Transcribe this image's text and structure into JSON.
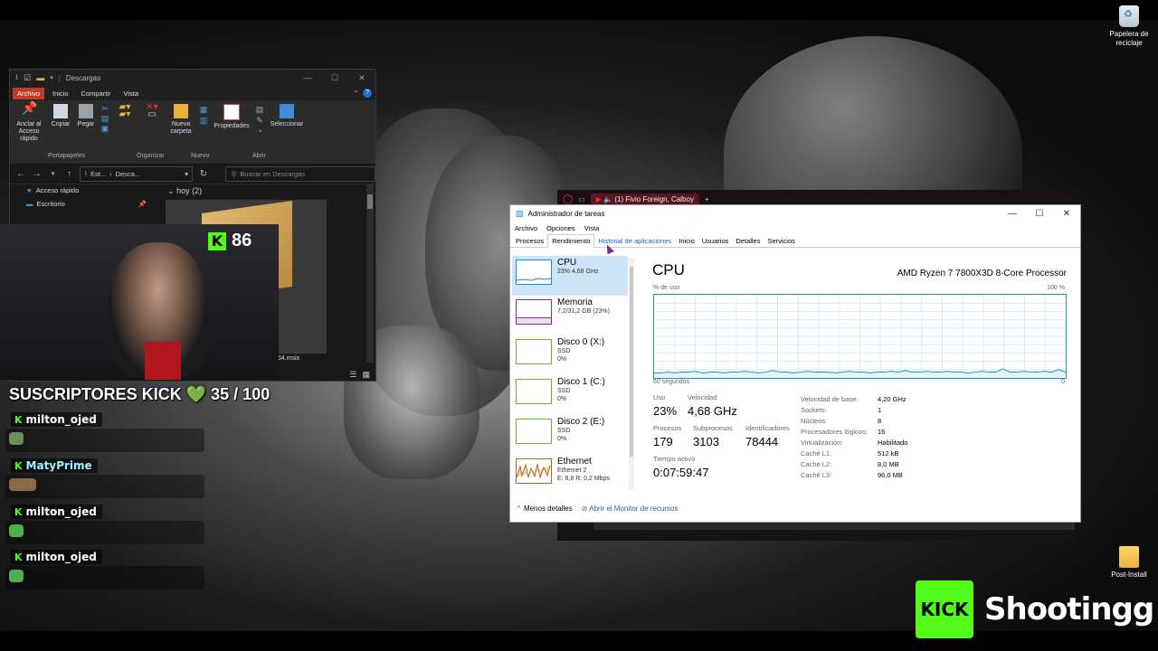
{
  "desktop": {
    "icons": [
      {
        "label": "Papelera de reciclaje"
      },
      {
        "label": "Post-Install"
      }
    ]
  },
  "explorer": {
    "title": "Descargas",
    "ribbon_tabs": [
      "Archivo",
      "Inicio",
      "Compartir",
      "Vista"
    ],
    "ribbon_buttons": {
      "pin": "Anclar al Acceso rápido",
      "copy": "Copiar",
      "paste": "Pegar",
      "new_folder": "Nueva carpeta",
      "properties": "Propiedades",
      "select": "Seleccionar"
    },
    "ribbon_groups": [
      "Portapapeles",
      "Organizar",
      "Nuevo",
      "Abrir"
    ],
    "address": {
      "part1": "Est...",
      "part2": "Desca..."
    },
    "search_placeholder": "Buscar en Descargas",
    "nav_items": [
      "Acceso rápido",
      "Escritorio"
    ],
    "group_header": "hoy (2)",
    "file_name_fragment": "54.msix"
  },
  "browser": {
    "tab_title": "(1) Fivio Foreign, Calboy",
    "new_tab": "+"
  },
  "stream_overlay": {
    "kick_count": "86",
    "subs_label": "SUSCRIPTORES KICK",
    "subs_value": "35 / 100",
    "heart": "💚",
    "chat": [
      {
        "user": "milton_ojed"
      },
      {
        "user": "MatyPrime"
      },
      {
        "user": "milton_ojed"
      },
      {
        "user": "milton_ojed"
      }
    ],
    "logo_text": "KICK",
    "channel": "Shootingg",
    "kick_letter": "K"
  },
  "taskmgr": {
    "title": "Administrador de tareas",
    "menu": [
      "Archivo",
      "Opciones",
      "Vista"
    ],
    "tabs": [
      "Procesos",
      "Rendimiento",
      "Historial de aplicaciones",
      "Inicio",
      "Usuarios",
      "Detalles",
      "Servicios"
    ],
    "perf_items": [
      {
        "name": "CPU",
        "sub1": "23% 4,68 GHz",
        "sub2": "",
        "sub3": ""
      },
      {
        "name": "Memoria",
        "sub1": "7,2/31,2 GB (23%)",
        "sub2": "",
        "sub3": ""
      },
      {
        "name": "Disco 0 (X:)",
        "sub1": "SSD",
        "sub2": "0%",
        "sub3": ""
      },
      {
        "name": "Disco 1 (C:)",
        "sub1": "SSD",
        "sub2": "0%",
        "sub3": ""
      },
      {
        "name": "Disco 2 (E:)",
        "sub1": "SSD",
        "sub2": "0%",
        "sub3": ""
      },
      {
        "name": "Ethernet",
        "sub1": "Ethernet 2",
        "sub2": "E: 8,8  R: 0,2 Mbps",
        "sub3": ""
      }
    ],
    "cpu_heading": "CPU",
    "cpu_model": "AMD Ryzen 7 7800X3D 8-Core Processor",
    "graph_label_left_top": "% de uso",
    "graph_label_right_top": "100 %",
    "graph_label_left_bottom": "60 segundos",
    "graph_label_right_bottom": "0",
    "usage_series": [
      6,
      6,
      7,
      6,
      7,
      7,
      8,
      6,
      7,
      7,
      6,
      7,
      7,
      8,
      7,
      6,
      7,
      9,
      7,
      7,
      6,
      7,
      8,
      7,
      7,
      7,
      6,
      7,
      8,
      7,
      7,
      6,
      7,
      7,
      8,
      7,
      9,
      7,
      7,
      8,
      7,
      7,
      8,
      7,
      7,
      6,
      7,
      8,
      7,
      7,
      11,
      7,
      7,
      8,
      7,
      7,
      8,
      7,
      10,
      7
    ],
    "stats": {
      "uso_label": "Uso",
      "uso": "23%",
      "velocidad_label": "Velocidad",
      "velocidad": "4,68 GHz",
      "procesos_label": "Procesos",
      "procesos": "179",
      "subprocesos_label": "Subprocesos",
      "subprocesos": "3103",
      "identificadores_label": "Identificadores",
      "identificadores": "78444",
      "tiempo_label": "Tiempo activo",
      "tiempo": "0:07:59:47"
    },
    "details": [
      {
        "k": "Velocidad de base:",
        "v": "4,20 GHz"
      },
      {
        "k": "Sockets:",
        "v": "1"
      },
      {
        "k": "Núcleos:",
        "v": "8"
      },
      {
        "k": "Procesadores lógicos:",
        "v": "16"
      },
      {
        "k": "Virtualización:",
        "v": "Habilitado"
      },
      {
        "k": "Caché L1:",
        "v": "512 kB"
      },
      {
        "k": "Caché L2:",
        "v": "8,0 MB"
      },
      {
        "k": "Caché L3:",
        "v": "96,0 MB"
      }
    ],
    "footer_less": "Menos detalles",
    "footer_monitor": "Abrir el Monitor de recursos"
  },
  "colors": {
    "kick_green": "#53fc18",
    "archivo_tab": "#c03a2b",
    "cpu_blue": "#1a8fd0",
    "memory_purple": "#8b2fa0",
    "disk_green": "#6ab02a",
    "ethernet_orange": "#b5651d"
  }
}
